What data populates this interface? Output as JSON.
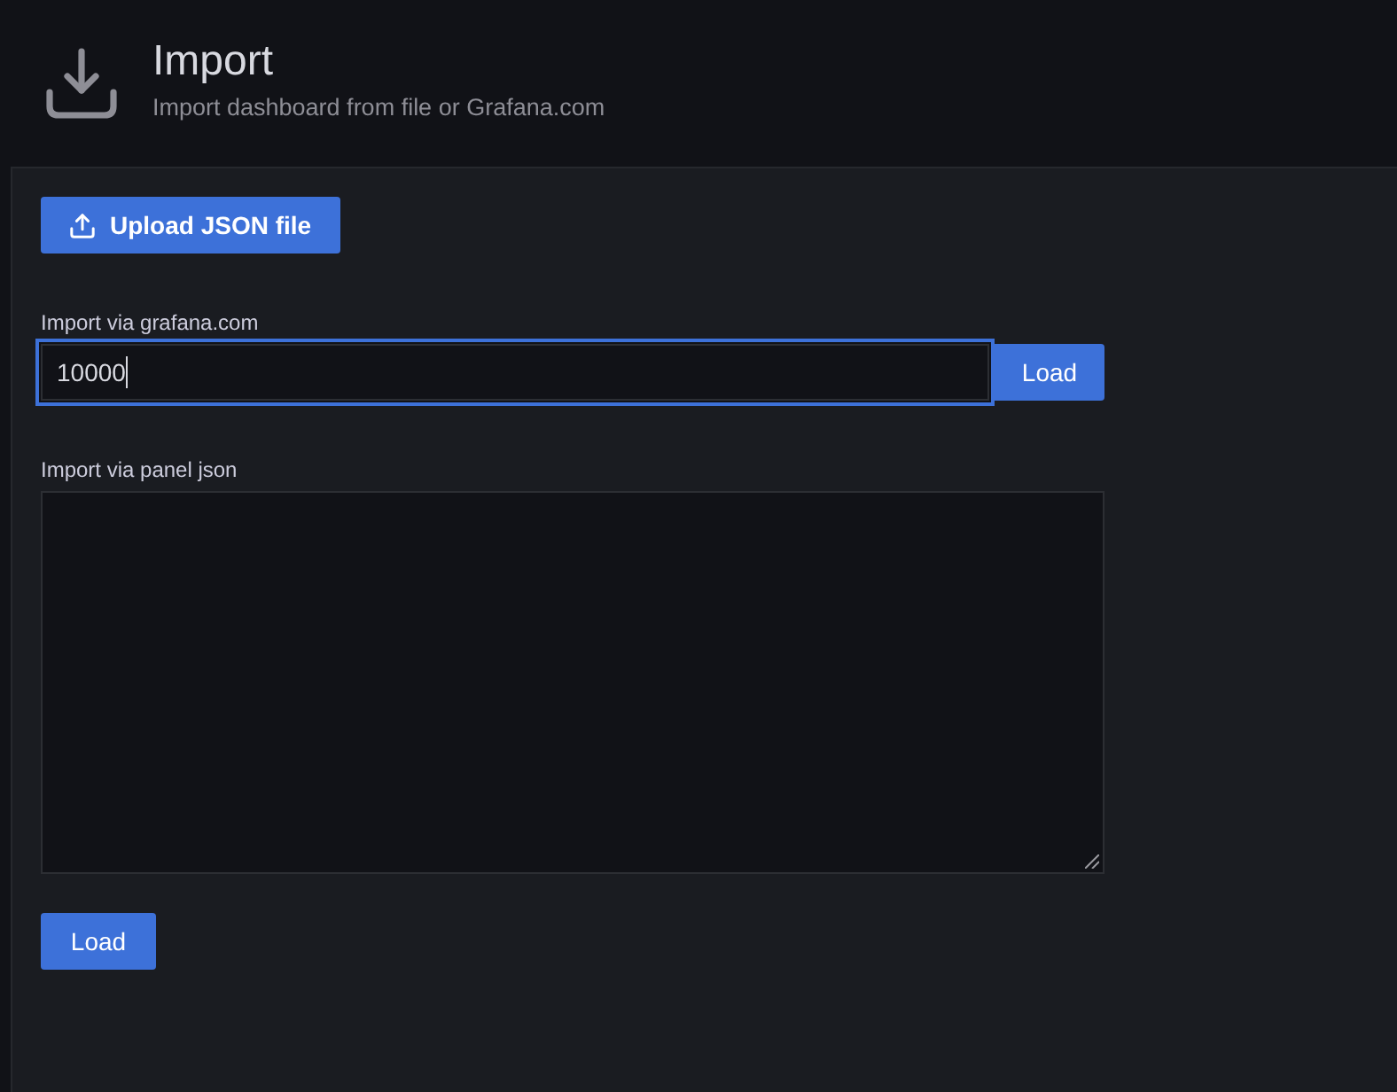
{
  "header": {
    "title": "Import",
    "subtitle": "Import dashboard from file or Grafana.com"
  },
  "upload_button": {
    "label": "Upload JSON file"
  },
  "grafana_import": {
    "label": "Import via grafana.com",
    "value": "10000",
    "focused": true,
    "button": "Load"
  },
  "panel_json": {
    "label": "Import via panel json",
    "button": "Load"
  }
}
